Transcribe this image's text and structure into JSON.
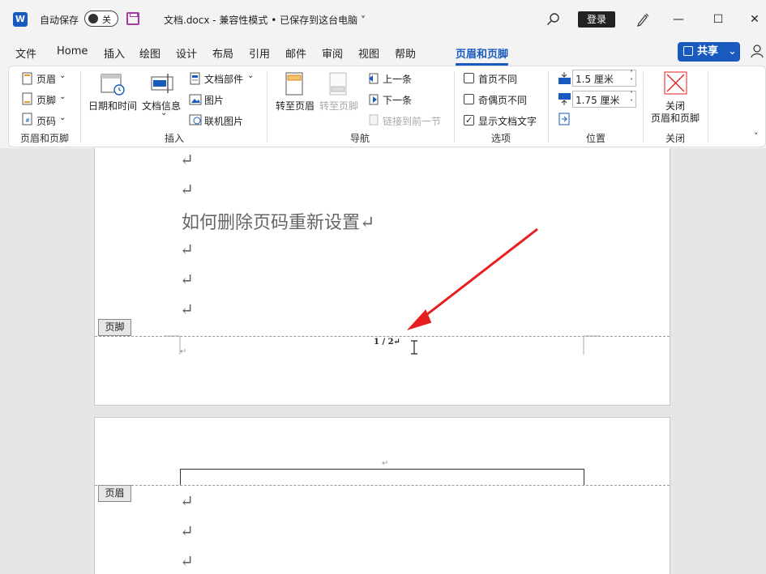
{
  "titlebar": {
    "app_icon": "word-icon",
    "app_letter": "W",
    "autosave_label": "自动保存",
    "autosave_state": "关",
    "doc_title": "文档.docx  -  兼容性模式 • 已保存到这台电脑  ˅",
    "login_label": "登录",
    "minimize": "—",
    "maximize": "☐",
    "close": "✕"
  },
  "tabs": [
    "文件",
    "Home",
    "插入",
    "绘图",
    "设计",
    "布局",
    "引用",
    "邮件",
    "审阅",
    "视图",
    "帮助",
    "页眉和页脚"
  ],
  "active_tab": "页眉和页脚",
  "share_label": "共享",
  "ribbon": {
    "header_footer": {
      "header_btn": "页眉",
      "footer_btn": "页脚",
      "pagenum_btn": "页码",
      "group": "页眉和页脚"
    },
    "insert": {
      "datetime": "日期和时间",
      "docinfo": "文档信息",
      "docparts": "文档部件",
      "picture": "图片",
      "online_picture": "联机图片",
      "group": "插入"
    },
    "nav": {
      "goto_header": "转至页眉",
      "goto_footer": "转至页脚",
      "prev": "上一条",
      "next": "下一条",
      "link_prev": "链接到前一节",
      "group": "导航"
    },
    "options": {
      "first_page": "首页不同",
      "odd_even": "奇偶页不同",
      "show_text": "显示文档文字",
      "group": "选项"
    },
    "position": {
      "header_dist": "1.5 厘米",
      "footer_dist": "1.75 厘米",
      "group": "位置"
    },
    "close": {
      "label_line1": "关闭",
      "label_line2": "页眉和页脚",
      "group": "关闭"
    }
  },
  "document": {
    "para_mark": "↵",
    "heading": "如何删除页码重新设置↵",
    "footer_tag": "页脚",
    "header_tag": "页眉",
    "page_number": "1 / 2↵",
    "small_mark": "↵"
  },
  "colors": {
    "accent": "#185abd",
    "arrow": "#e81e1e"
  }
}
